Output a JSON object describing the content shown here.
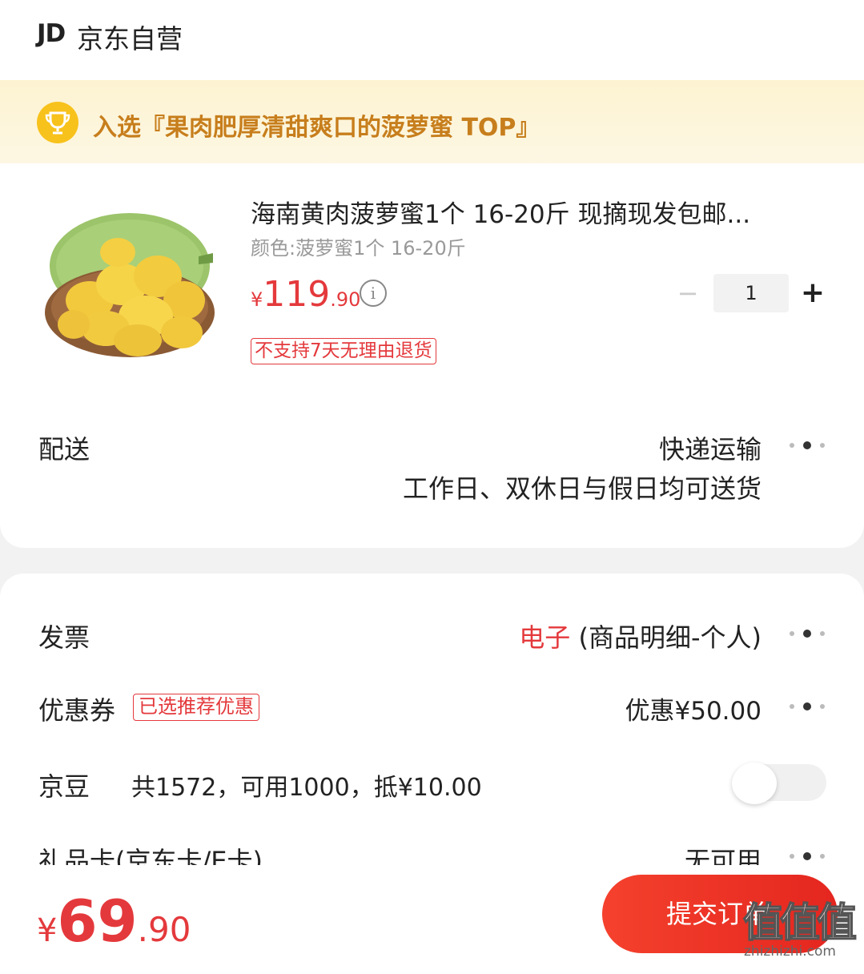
{
  "header": {
    "logo_text": "JD",
    "title": "京东自营"
  },
  "banner": {
    "text": "入选『果肉肥厚清甜爽口的菠萝蜜 TOP』",
    "icon": "trophy-icon"
  },
  "product": {
    "title": "海南黄肉菠萝蜜1个 16-20斤 现摘现发包邮...",
    "spec": "颜色:菠萝蜜1个 16-20斤",
    "price_symbol": "¥",
    "price_int": "119",
    "price_dec": ".90",
    "info_icon": "i",
    "quantity": "1",
    "minus_label": "−",
    "plus_label": "+",
    "return_policy": "不支持7天无理由退货"
  },
  "delivery": {
    "label": "配送",
    "method": "快递运输",
    "note": "工作日、双休日与假日均可送货"
  },
  "invoice": {
    "label": "发票",
    "type": "电子",
    "detail": " (商品明细-个人)"
  },
  "coupon": {
    "label": "优惠券",
    "tag": "已选推荐优惠",
    "value": "优惠¥50.00"
  },
  "jingdou": {
    "label": "京豆",
    "text": "共1572，可用1000，抵¥10.00",
    "enabled": false
  },
  "giftcard": {
    "label": "礼品卡(京东卡/E卡)",
    "value": "无可用"
  },
  "footer": {
    "total_symbol": "¥",
    "total_int": "69",
    "total_dec": ".90",
    "submit_label": "提交订单"
  },
  "watermark": {
    "logo": "值值值",
    "url": "zhizhizhi.com"
  },
  "colors": {
    "accent": "#e4393c",
    "banner_text": "#c77e1c",
    "banner_bg": "#fdf3d2"
  }
}
